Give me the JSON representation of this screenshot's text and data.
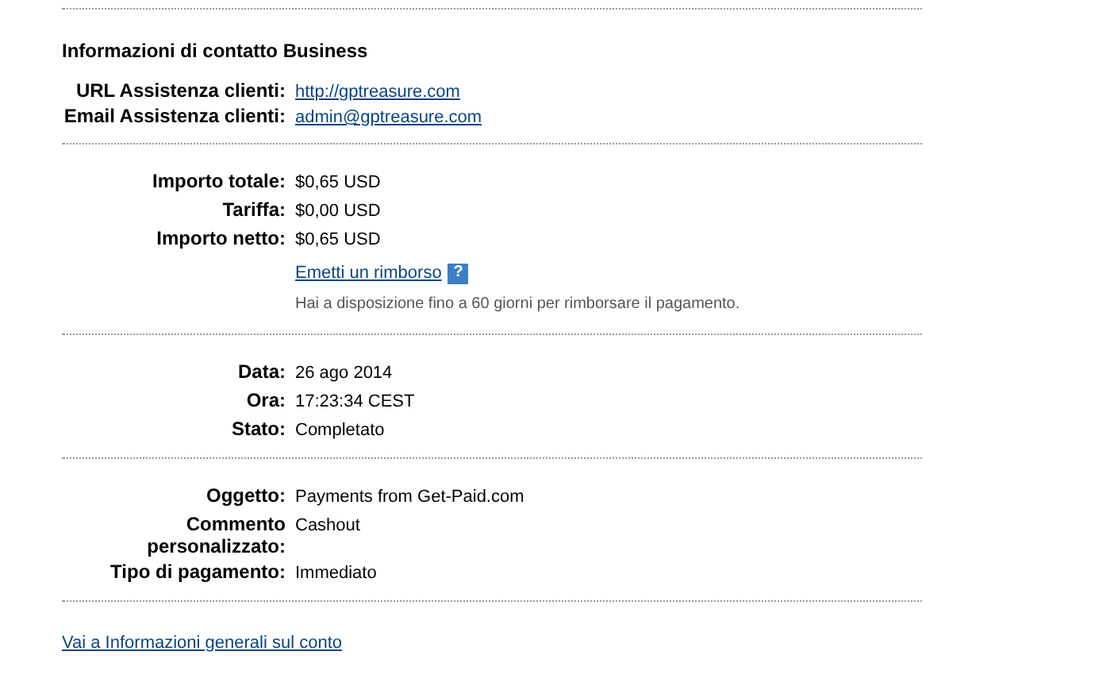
{
  "contact": {
    "title": "Informazioni di contatto Business",
    "rows": [
      {
        "label": "URL Assistenza clienti:",
        "value": "http://gptreasure.com",
        "kind": "link"
      },
      {
        "label": "Email Assistenza clienti:",
        "value": "admin@gptreasure.com",
        "kind": "link"
      }
    ]
  },
  "amounts": {
    "rows": [
      {
        "label": "Importo totale:",
        "value": "$0,65 USD",
        "kind": "text"
      },
      {
        "label": "Tariffa:",
        "value": "$0,00 USD",
        "kind": "text"
      },
      {
        "label": "Importo netto:",
        "value": "$0,65 USD",
        "kind": "text"
      }
    ],
    "refund_link": "Emetti un rimborso",
    "help_icon": "?",
    "note": "Hai a disposizione fino a 60 giorni per rimborsare il pagamento."
  },
  "details": {
    "rows": [
      {
        "label": "Data:",
        "value": "26 ago 2014",
        "kind": "text"
      },
      {
        "label": "Ora:",
        "value": "17:23:34 CEST",
        "kind": "text"
      },
      {
        "label": "Stato:",
        "value": "Completato",
        "kind": "text"
      }
    ]
  },
  "payment": {
    "rows": [
      {
        "label": "Oggetto:",
        "value": "Payments from Get-Paid.com",
        "kind": "text"
      },
      {
        "label": "Commento personalizzato:",
        "value": "Cashout",
        "kind": "text"
      },
      {
        "label": "Tipo di pagamento:",
        "value": "Immediato",
        "kind": "text"
      }
    ]
  },
  "footer_link": "Vai a Informazioni generali sul conto"
}
